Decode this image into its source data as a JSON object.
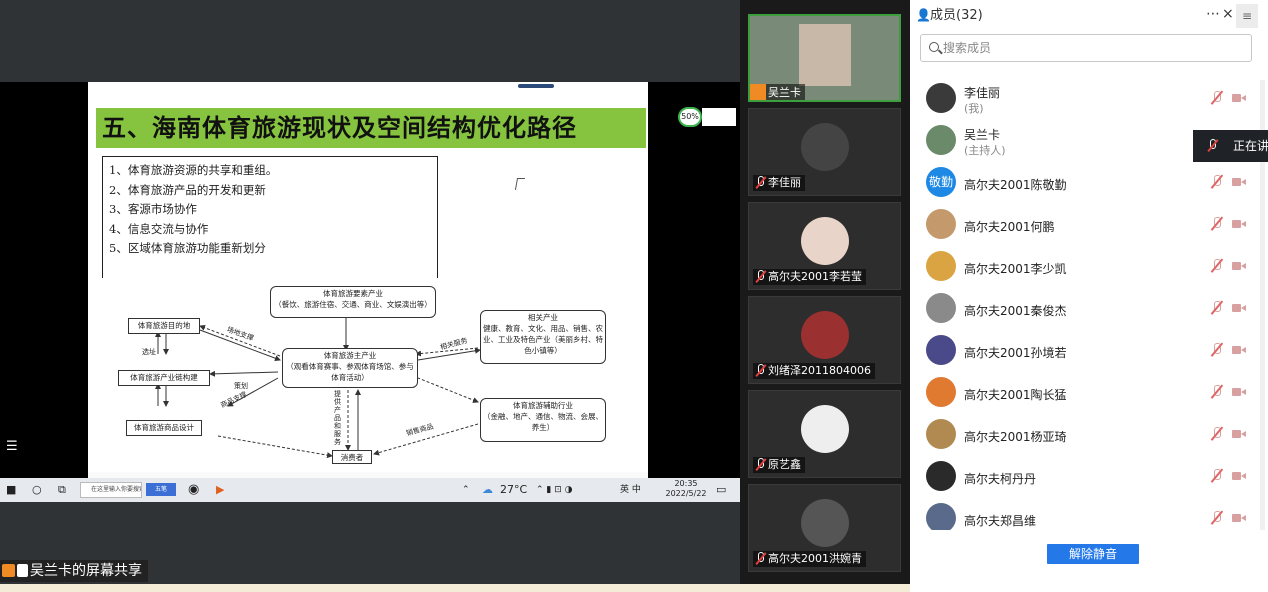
{
  "share": {
    "slide": {
      "title": "五、海南体育旅游现状及空间结构优化路径",
      "list": [
        "1、体育旅游资源的共享和重组。",
        "2、体育旅游产品的开发和更新",
        "3、客源市场协作",
        "4、信息交流与协作",
        "5、区域体育旅游功能重新划分"
      ],
      "diagram": {
        "top_box": "体育旅游要素产业\n（餐饮、旅游住宿、交通、商业、文娱演出等）",
        "center_box": "体育旅游主产业\n（观看体育赛事、参观体育场馆、参与体育活动）",
        "related_box": "相关产业\n健康、教育、文化、用品、销售、农业、工业及特色产业（美丽乡村、特色小镇等）",
        "aux_box": "体育旅游辅助行业\n（金融、地产、通信、物流、会展、养生）",
        "dest_box": "体育旅游目的地",
        "chain_box": "体育旅游产业链构建",
        "goods_box": "体育旅游商品设计",
        "consumer_box": "消费者",
        "label_site": "场地支撑",
        "label_related": "相关服务",
        "label_plan": "策划",
        "label_goods": "商品支撑",
        "label_provide": "提供产品和服务",
        "label_sell": "销售商品",
        "label_location": "选址"
      }
    },
    "percent_badge": "50%",
    "taskbar": {
      "search_placeholder": "在这里输入你要搜索的内容",
      "ime_label": "五笔",
      "weather": "27°C",
      "input_mode": "英 中",
      "time": "20:35",
      "date": "2022/5/22"
    },
    "share_label": "吴兰卡的屏幕共享"
  },
  "videos": [
    {
      "name": "吴兰卡",
      "active": true
    },
    {
      "name": "李佳丽"
    },
    {
      "name": "高尔夫2001李若莹"
    },
    {
      "name": "刘绪泽2011804006"
    },
    {
      "name": "原艺鑫"
    },
    {
      "name": "高尔夫2001洪婉青"
    }
  ],
  "panel": {
    "title": "成员(32)",
    "more_icon": "⋯",
    "close_icon": "×",
    "menu_icon": "≡",
    "search_placeholder": "搜索成员",
    "members": [
      {
        "name": "李佳丽",
        "sub": "(我)",
        "color": "#3a3a3a"
      },
      {
        "name": "吴兰卡",
        "sub": "(主持人)",
        "color": "#6a8a6a"
      },
      {
        "name": "高尔夫2001陈敬勤",
        "avatar_text": "敬勤",
        "color": "#1e88e5"
      },
      {
        "name": "高尔夫2001何鹏",
        "color": "#c49a6c"
      },
      {
        "name": "高尔夫2001李少凯",
        "color": "#d9a441"
      },
      {
        "name": "高尔夫2001秦俊杰",
        "color": "#8a8a8a"
      },
      {
        "name": "高尔夫2001孙境若",
        "color": "#4a4a8a"
      },
      {
        "name": "高尔夫2001陶长猛",
        "color": "#e07a30"
      },
      {
        "name": "高尔夫2001杨亚琦",
        "color": "#b08a50"
      },
      {
        "name": "高尔夫柯丹丹",
        "color": "#2a2a2a"
      },
      {
        "name": "高尔夫郑昌维",
        "color": "#5a6a8a"
      }
    ],
    "unmute_all": "解除静音"
  },
  "speaking_toast": "正在讲话"
}
